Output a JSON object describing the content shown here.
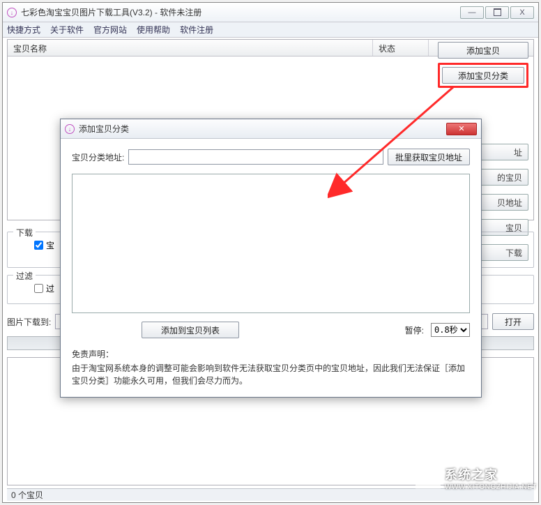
{
  "window": {
    "title": "七彩色淘宝宝贝图片下载工具(V3.2)  -  软件未注册",
    "min": "—",
    "close": "X"
  },
  "menu": {
    "items": [
      "快捷方式",
      "关于软件",
      "官方网站",
      "使用帮助",
      "软件注册"
    ]
  },
  "table": {
    "col_name": "宝贝名称",
    "col_status": "状态"
  },
  "sidebar": {
    "add_item": "添加宝贝",
    "add_category": "添加宝贝分类",
    "stub1": "址",
    "stub2": "的宝贝",
    "stub3": "贝地址",
    "stub4": "宝贝",
    "stub5": "下载"
  },
  "groups": {
    "download": "下载",
    "download_chk": "宝",
    "filter": "过滤",
    "filter_chk": "过"
  },
  "row": {
    "label": "图片下载到:",
    "open": "打开"
  },
  "status": "0 个宝贝",
  "dialog": {
    "title": "添加宝贝分类",
    "url_label": "宝贝分类地址:",
    "batch_btn": "批里获取宝贝地址",
    "add_btn": "添加到宝贝列表",
    "pause_label": "暂停:",
    "pause_value": "0.8秒",
    "disclaimer_h": "免责声明：",
    "disclaimer_body": "由于淘宝网系统本身的调整可能会影响到软件无法获取宝贝分类页中的宝贝地址，因此我们无法保证［添加宝贝分类］功能永久可用，但我们会尽力而为。"
  },
  "watermark": {
    "name": "系统之家",
    "url": "WWW.XITONGZHIJIA.NET"
  }
}
